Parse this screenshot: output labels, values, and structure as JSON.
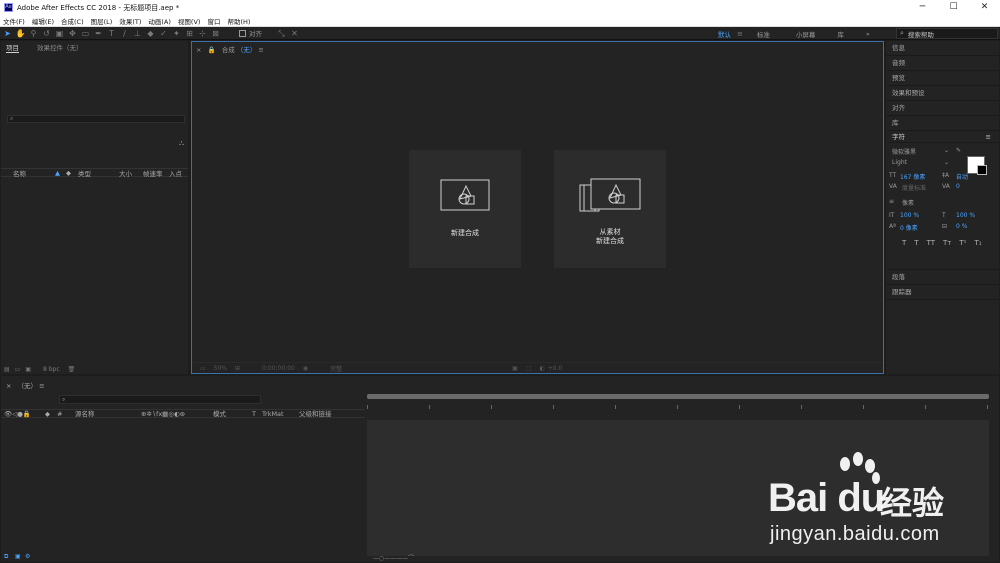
{
  "window": {
    "title": "Adobe After Effects CC 2018 - 无标题项目.aep *",
    "app_icon_text": "Ae",
    "minimize": "─",
    "maximize": "☐",
    "close": "✕"
  },
  "menu": [
    "文件(F)",
    "编辑(E)",
    "合成(C)",
    "图层(L)",
    "效果(T)",
    "动画(A)",
    "视图(V)",
    "窗口",
    "帮助(H)"
  ],
  "toolbar": {
    "snap_label": "对齐",
    "workspaces": [
      "默认",
      "标准",
      "小屏幕",
      "库"
    ],
    "workspace_menu": "≡",
    "overflow": "»",
    "search_help_placeholder": "搜索帮助"
  },
  "project_panel": {
    "tabs": [
      "项目",
      "效果控件（无）"
    ],
    "columns": [
      "名称",
      "类型",
      "大小",
      "帧速率",
      "入点"
    ],
    "bpc": "8 bpc"
  },
  "composition_panel": {
    "tab_prefix": "合成",
    "tab_name": "（无）",
    "new_comp_label": "新建合成",
    "from_footage_line1": "从素材",
    "from_footage_line2": "新建合成",
    "zoom": "50%",
    "timecode": "0;00;00;00",
    "resolution": "完整",
    "offset": "+0.0"
  },
  "right_panels": {
    "items": [
      "信息",
      "音频",
      "预览",
      "效果和预设",
      "对齐",
      "库"
    ],
    "character_title": "字符",
    "font_family": "微软雅黑",
    "font_style": "Light",
    "font_size": "167 像素",
    "leading": "自动",
    "kerning": "度量标准",
    "tracking": "0",
    "stroke_width": "像素",
    "vert_scale": "100 %",
    "horiz_scale": "100 %",
    "baseline": "0 像素",
    "tsume": "0 %",
    "text_styles": [
      "T",
      "T",
      "TT",
      "Tт",
      "T¹",
      "T₁"
    ],
    "paragraph": "段落",
    "tracker": "跟踪器"
  },
  "timeline": {
    "tab_name": "（无）",
    "columns": [
      "源名称",
      "模式",
      "T",
      "TrkMat",
      "父级和链接"
    ]
  },
  "watermark": {
    "brand": "Bai du",
    "cn": "经验",
    "url": "jingyan.baidu.com"
  }
}
